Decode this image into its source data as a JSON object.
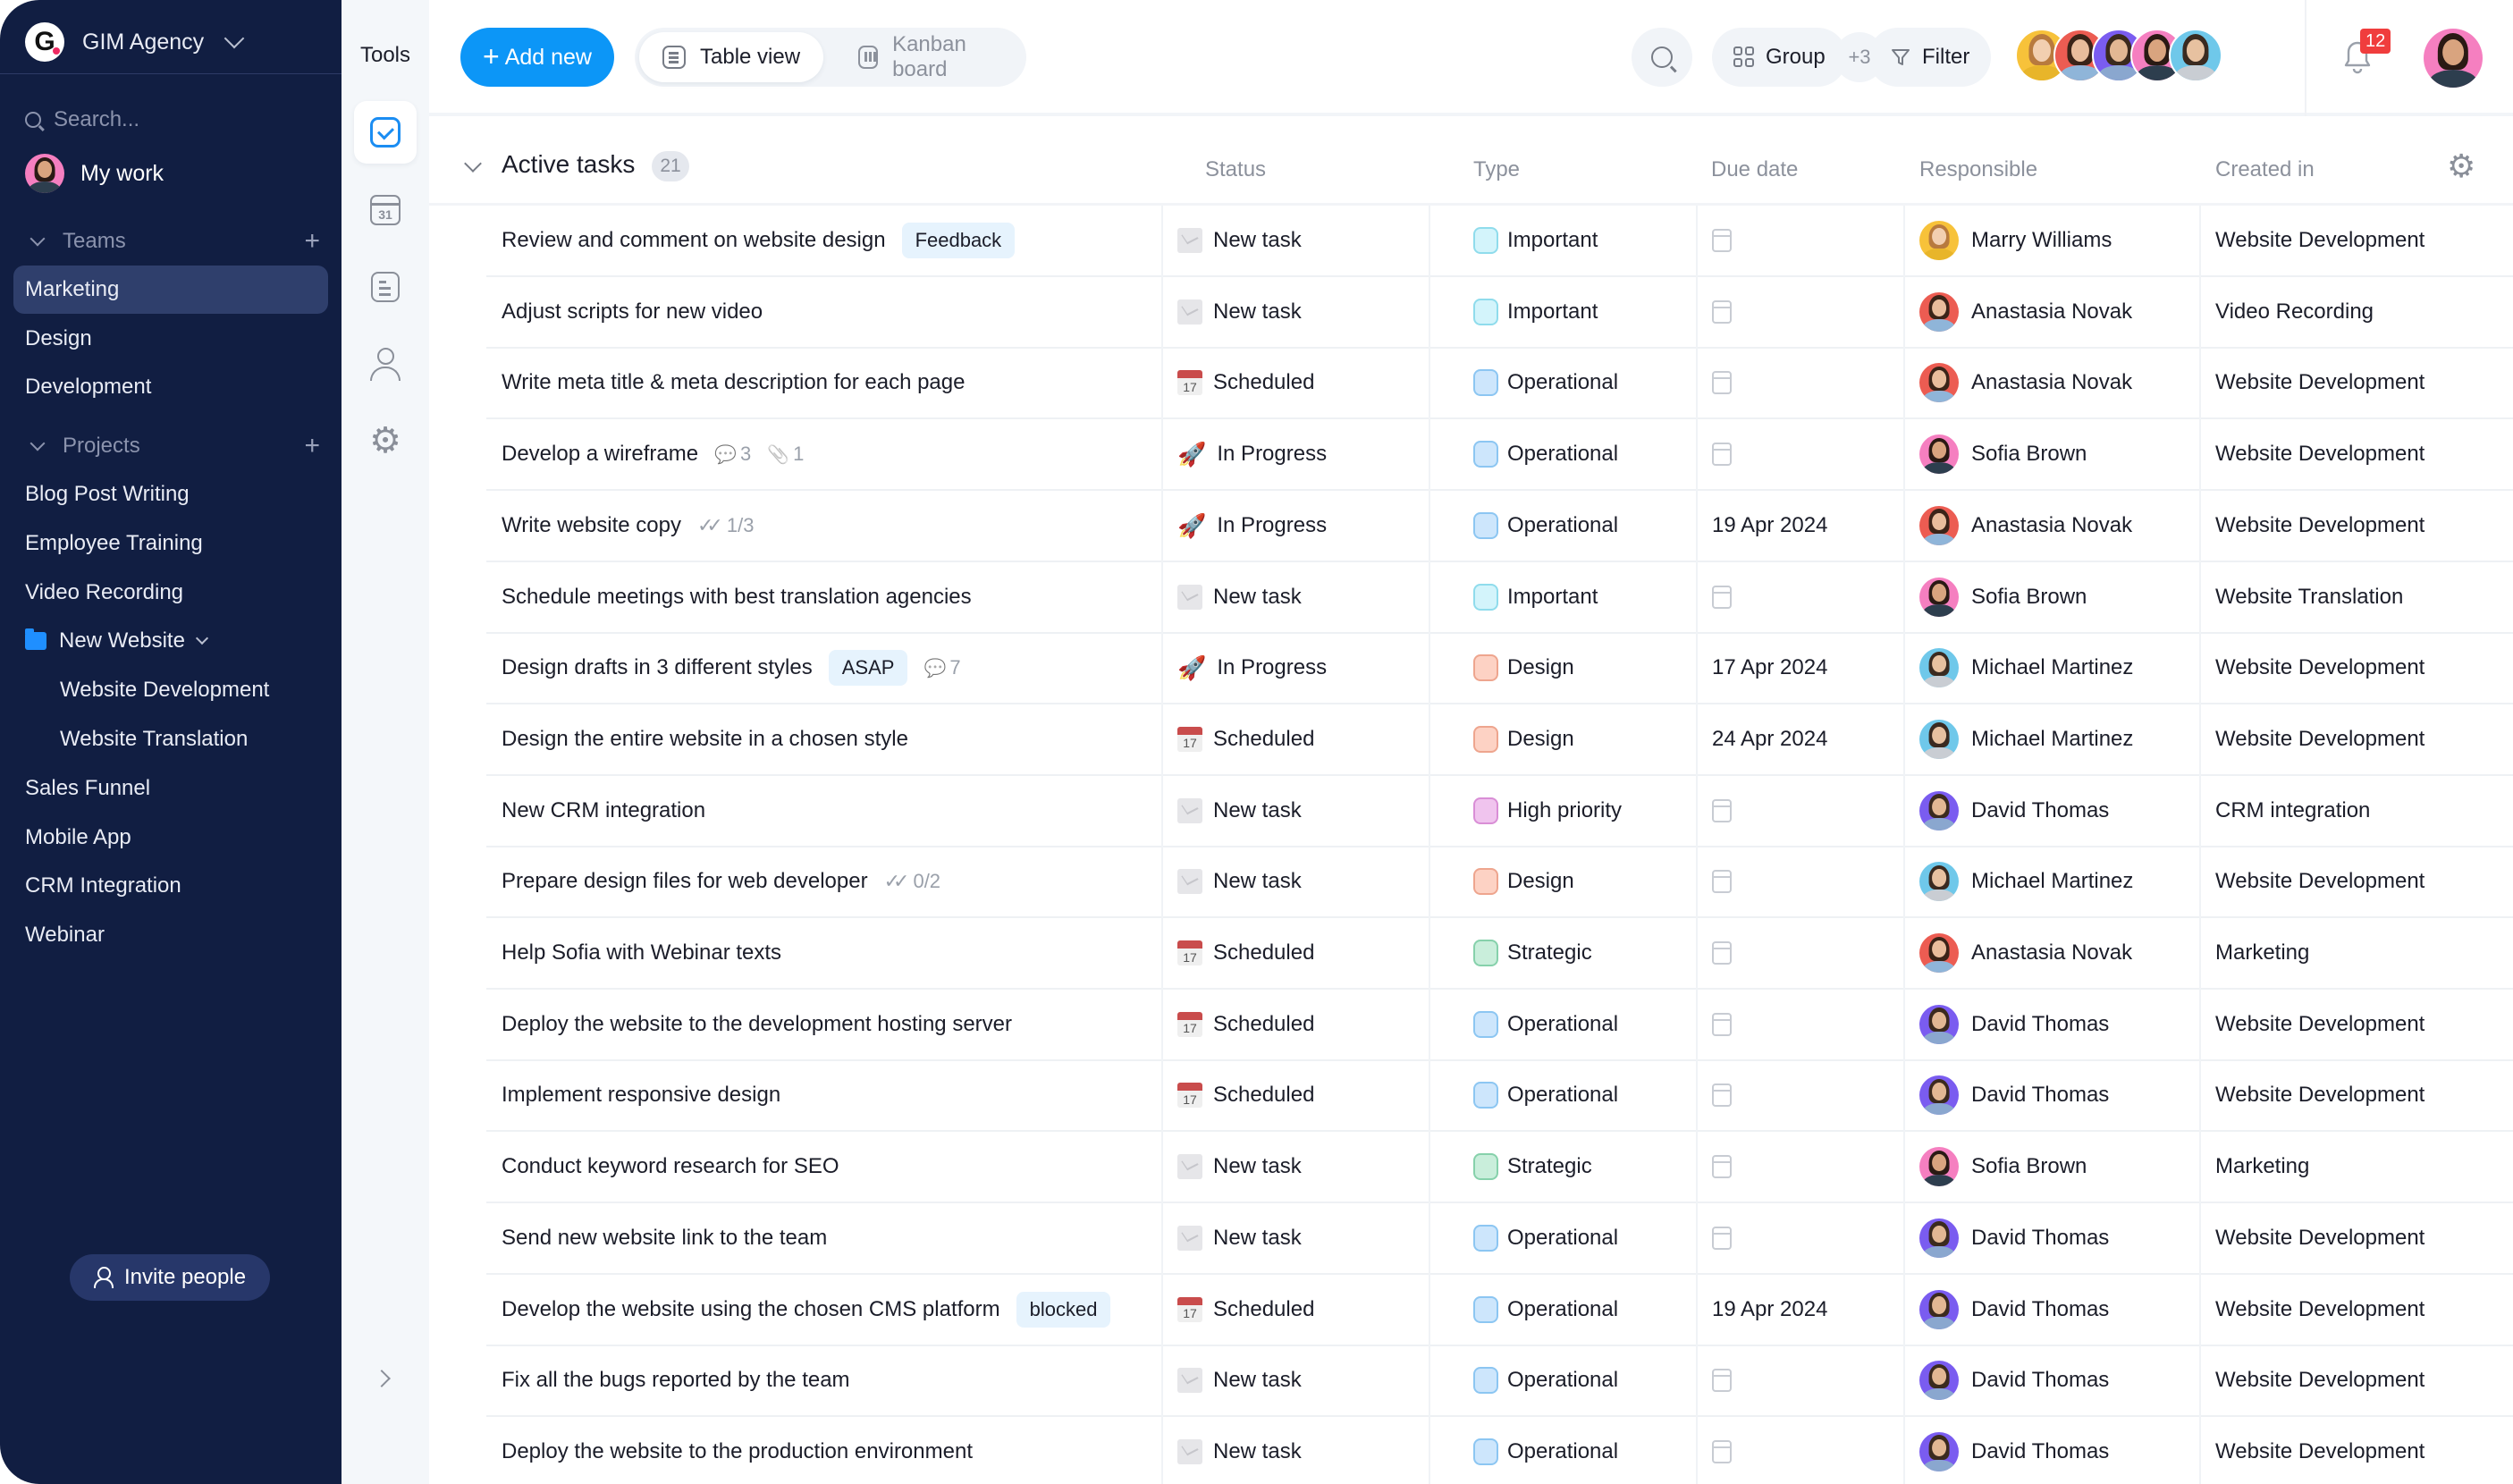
{
  "sidebar": {
    "org_name": "GIM Agency",
    "org_logo_letter": "G",
    "search_placeholder": "Search...",
    "my_work_label": "My work",
    "teams_label": "Teams",
    "projects_label": "Projects",
    "teams": [
      {
        "label": "Marketing",
        "active": true
      },
      {
        "label": "Design"
      },
      {
        "label": "Development"
      }
    ],
    "projects": [
      {
        "label": "Blog Post Writing"
      },
      {
        "label": "Employee Training"
      },
      {
        "label": "Video Recording"
      },
      {
        "label": "New Website",
        "folder": true,
        "expanded": true
      },
      {
        "label": "Website Development",
        "sub": true
      },
      {
        "label": "Website Translation",
        "sub": true
      },
      {
        "label": "Sales Funnel"
      },
      {
        "label": "Mobile App"
      },
      {
        "label": "CRM Integration"
      },
      {
        "label": "Webinar"
      }
    ],
    "invite_label": "Invite people"
  },
  "tools": {
    "title": "Tools",
    "items": [
      {
        "icon": "tasks-check-icon",
        "active": true
      },
      {
        "icon": "calendar-icon",
        "text": "31"
      },
      {
        "icon": "document-icon"
      },
      {
        "icon": "user-icon"
      },
      {
        "icon": "settings-gear-icon"
      }
    ]
  },
  "topbar": {
    "add_new_label": "Add new",
    "views": [
      {
        "label": "Table view",
        "active": true
      },
      {
        "label": "Kanban board",
        "active": false
      }
    ],
    "group_label": "Group",
    "filter_label": "Filter",
    "members_more": "+3",
    "notifications_count": "12"
  },
  "table": {
    "group_title": "Active tasks",
    "group_count": "21",
    "columns": [
      "Status",
      "Type",
      "Due date",
      "Responsible",
      "Created in"
    ],
    "type_colors": {
      "Important": {
        "bg": "#d3f4fb",
        "border": "#8fdcec"
      },
      "Operational": {
        "bg": "#cde6fc",
        "border": "#8cc6f2"
      },
      "Design": {
        "bg": "#fdd2c4",
        "border": "#eea58e"
      },
      "High priority": {
        "bg": "#f0c4ee",
        "border": "#d98ed6"
      },
      "Strategic": {
        "bg": "#c9eedb",
        "border": "#86d1ab"
      }
    },
    "people": {
      "Marry Williams": {
        "bg": "#f7c23a",
        "hair": "#b87a3e",
        "skin": "#f2cfb0",
        "shirt": "#e8b52a"
      },
      "Anastasia Novak": {
        "bg": "#ec5c52",
        "hair": "#3b2418",
        "skin": "#e9bd9c",
        "shirt": "#8fb5d9"
      },
      "Sofia Brown": {
        "bg": "#f57fc0",
        "hair": "#2a1a14",
        "skin": "#d9a47f",
        "shirt": "#2d3e4e"
      },
      "Michael Martinez": {
        "bg": "#6fc8ea",
        "hair": "#3a2a20",
        "skin": "#e7c1a0",
        "shirt": "#c9cdd3"
      },
      "David Thomas": {
        "bg": "#7a5cf0",
        "hair": "#3b2a1e",
        "skin": "#e2b793",
        "shirt": "#8aa7cf"
      }
    },
    "rows": [
      {
        "title": "Review and comment on website design",
        "tag": "Feedback",
        "status": "New task",
        "type": "Important",
        "due": "",
        "responsible": "Marry Williams",
        "created_in": "Website Development"
      },
      {
        "title": "Adjust scripts for new video",
        "status": "New task",
        "type": "Important",
        "due": "",
        "responsible": "Anastasia Novak",
        "created_in": "Video Recording"
      },
      {
        "title": "Write meta title & meta description for each page",
        "status": "Scheduled",
        "type": "Operational",
        "due": "",
        "responsible": "Anastasia Novak",
        "created_in": "Website Development"
      },
      {
        "title": "Develop a wireframe",
        "comments": "3",
        "attachments": "1",
        "status": "In Progress",
        "type": "Operational",
        "due": "",
        "responsible": "Sofia Brown",
        "created_in": "Website Development"
      },
      {
        "title": "Write website copy",
        "subtasks": "1/3",
        "status": "In Progress",
        "type": "Operational",
        "due": "19 Apr 2024",
        "responsible": "Anastasia Novak",
        "created_in": "Website Development"
      },
      {
        "title": "Schedule meetings with best translation agencies",
        "status": "New task",
        "type": "Important",
        "due": "",
        "responsible": "Sofia Brown",
        "created_in": "Website Translation"
      },
      {
        "title": "Design drafts in 3 different styles",
        "tag": "ASAP",
        "comments": "7",
        "status": "In Progress",
        "type": "Design",
        "due": "17 Apr 2024",
        "responsible": "Michael Martinez",
        "created_in": "Website Development"
      },
      {
        "title": "Design the entire website in a chosen style",
        "status": "Scheduled",
        "type": "Design",
        "due": "24 Apr 2024",
        "responsible": "Michael Martinez",
        "created_in": "Website Development"
      },
      {
        "title": "New CRM integration",
        "status": "New task",
        "type": "High priority",
        "due": "",
        "responsible": "David Thomas",
        "created_in": "CRM integration"
      },
      {
        "title": "Prepare design files for web developer",
        "subtasks": "0/2",
        "status": "New task",
        "type": "Design",
        "due": "",
        "responsible": "Michael Martinez",
        "created_in": "Website Development"
      },
      {
        "title": "Help Sofia with Webinar texts",
        "status": "Scheduled",
        "type": "Strategic",
        "due": "",
        "responsible": "Anastasia Novak",
        "created_in": "Marketing"
      },
      {
        "title": "Deploy the website to the development hosting server",
        "status": "Scheduled",
        "type": "Operational",
        "due": "",
        "responsible": "David Thomas",
        "created_in": "Website Development"
      },
      {
        "title": "Implement responsive design",
        "status": "Scheduled",
        "type": "Operational",
        "due": "",
        "responsible": "David Thomas",
        "created_in": "Website Development"
      },
      {
        "title": "Conduct keyword research for SEO",
        "status": "New task",
        "type": "Strategic",
        "due": "",
        "responsible": "Sofia Brown",
        "created_in": "Marketing"
      },
      {
        "title": "Send new website link to the team",
        "status": "New task",
        "type": "Operational",
        "due": "",
        "responsible": "David Thomas",
        "created_in": "Website Development"
      },
      {
        "title": "Develop the website using the chosen CMS platform",
        "tag": "blocked",
        "status": "Scheduled",
        "type": "Operational",
        "due": "19 Apr 2024",
        "responsible": "David Thomas",
        "created_in": "Website Development"
      },
      {
        "title": "Fix all the bugs reported by the team",
        "status": "New task",
        "type": "Operational",
        "due": "",
        "responsible": "David Thomas",
        "created_in": "Website Development"
      },
      {
        "title": "Deploy the website to the production environment",
        "status": "New task",
        "type": "Operational",
        "due": "",
        "responsible": "David Thomas",
        "created_in": "Website Development"
      }
    ]
  },
  "colors": {
    "sidebar_bg": "#111e42",
    "accent": "#0c96f7",
    "badge": "#f03d3d"
  }
}
